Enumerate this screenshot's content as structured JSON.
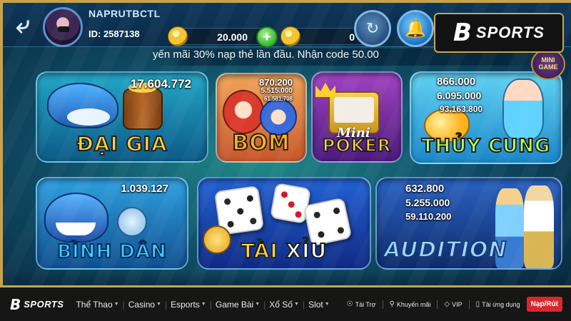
{
  "player": {
    "username": "NAPRUTBCTL",
    "id_text": "ID: 2587138"
  },
  "wallet": {
    "gold": "20.000",
    "silver": "0"
  },
  "brand": {
    "logo_letter": "B",
    "logo_text": "SPORTS"
  },
  "marquee": "yến mãi 30% nạp thẻ lần đầu. Nhận code 50.00",
  "mini_game_label": "MINI GAME",
  "games": {
    "dai_gia": {
      "title": "ĐẠI GIA",
      "jackpot": "17.604.772"
    },
    "bom": {
      "title": "BOM",
      "j1": "870.200",
      "j2": "5.515.000",
      "j3": "61.581.708"
    },
    "poker": {
      "title": "POKER",
      "mini": "Mini"
    },
    "thuy_cung": {
      "title": "THỦY CUNG",
      "j1": "866.000",
      "j2": "6.095.000",
      "j3": "93.163.800"
    },
    "binh_dan": {
      "title": "BÌNH DÂN",
      "jackpot": "1.039.127"
    },
    "tai_xiu": {
      "title_a": "TÀI ",
      "title_b": "XỈU"
    },
    "audition": {
      "title": "AUDITION",
      "j1": "632.800",
      "j2": "5.255.000",
      "j3": "59.110.200"
    }
  },
  "sitebar": {
    "logo_letter": "B",
    "logo_text": "SPORTS",
    "menu": [
      "Thể Thao",
      "Casino",
      "Esports",
      "Game Bài",
      "Xổ Số",
      "Slot"
    ],
    "links": [
      "Tài Trợ",
      "Khuyến mãi",
      "VIP",
      "Tải ứng dụng"
    ],
    "cta": "Nạp/Rút"
  },
  "colors": {
    "frame_gold": "#c8a24a",
    "cta_red": "#d9282b",
    "bar_bg": "#161616"
  }
}
